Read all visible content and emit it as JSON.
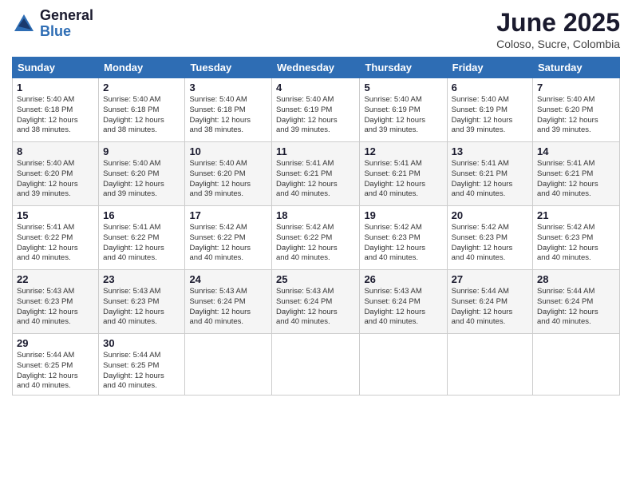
{
  "logo": {
    "general": "General",
    "blue": "Blue"
  },
  "title": "June 2025",
  "subtitle": "Coloso, Sucre, Colombia",
  "days_of_week": [
    "Sunday",
    "Monday",
    "Tuesday",
    "Wednesday",
    "Thursday",
    "Friday",
    "Saturday"
  ],
  "weeks": [
    [
      {
        "day": "1",
        "sunrise": "5:40 AM",
        "sunset": "6:18 PM",
        "daylight": "12 hours and 38 minutes."
      },
      {
        "day": "2",
        "sunrise": "5:40 AM",
        "sunset": "6:18 PM",
        "daylight": "12 hours and 38 minutes."
      },
      {
        "day": "3",
        "sunrise": "5:40 AM",
        "sunset": "6:18 PM",
        "daylight": "12 hours and 38 minutes."
      },
      {
        "day": "4",
        "sunrise": "5:40 AM",
        "sunset": "6:19 PM",
        "daylight": "12 hours and 39 minutes."
      },
      {
        "day": "5",
        "sunrise": "5:40 AM",
        "sunset": "6:19 PM",
        "daylight": "12 hours and 39 minutes."
      },
      {
        "day": "6",
        "sunrise": "5:40 AM",
        "sunset": "6:19 PM",
        "daylight": "12 hours and 39 minutes."
      },
      {
        "day": "7",
        "sunrise": "5:40 AM",
        "sunset": "6:20 PM",
        "daylight": "12 hours and 39 minutes."
      }
    ],
    [
      {
        "day": "8",
        "sunrise": "5:40 AM",
        "sunset": "6:20 PM",
        "daylight": "12 hours and 39 minutes."
      },
      {
        "day": "9",
        "sunrise": "5:40 AM",
        "sunset": "6:20 PM",
        "daylight": "12 hours and 39 minutes."
      },
      {
        "day": "10",
        "sunrise": "5:40 AM",
        "sunset": "6:20 PM",
        "daylight": "12 hours and 39 minutes."
      },
      {
        "day": "11",
        "sunrise": "5:41 AM",
        "sunset": "6:21 PM",
        "daylight": "12 hours and 40 minutes."
      },
      {
        "day": "12",
        "sunrise": "5:41 AM",
        "sunset": "6:21 PM",
        "daylight": "12 hours and 40 minutes."
      },
      {
        "day": "13",
        "sunrise": "5:41 AM",
        "sunset": "6:21 PM",
        "daylight": "12 hours and 40 minutes."
      },
      {
        "day": "14",
        "sunrise": "5:41 AM",
        "sunset": "6:21 PM",
        "daylight": "12 hours and 40 minutes."
      }
    ],
    [
      {
        "day": "15",
        "sunrise": "5:41 AM",
        "sunset": "6:22 PM",
        "daylight": "12 hours and 40 minutes."
      },
      {
        "day": "16",
        "sunrise": "5:41 AM",
        "sunset": "6:22 PM",
        "daylight": "12 hours and 40 minutes."
      },
      {
        "day": "17",
        "sunrise": "5:42 AM",
        "sunset": "6:22 PM",
        "daylight": "12 hours and 40 minutes."
      },
      {
        "day": "18",
        "sunrise": "5:42 AM",
        "sunset": "6:22 PM",
        "daylight": "12 hours and 40 minutes."
      },
      {
        "day": "19",
        "sunrise": "5:42 AM",
        "sunset": "6:23 PM",
        "daylight": "12 hours and 40 minutes."
      },
      {
        "day": "20",
        "sunrise": "5:42 AM",
        "sunset": "6:23 PM",
        "daylight": "12 hours and 40 minutes."
      },
      {
        "day": "21",
        "sunrise": "5:42 AM",
        "sunset": "6:23 PM",
        "daylight": "12 hours and 40 minutes."
      }
    ],
    [
      {
        "day": "22",
        "sunrise": "5:43 AM",
        "sunset": "6:23 PM",
        "daylight": "12 hours and 40 minutes."
      },
      {
        "day": "23",
        "sunrise": "5:43 AM",
        "sunset": "6:23 PM",
        "daylight": "12 hours and 40 minutes."
      },
      {
        "day": "24",
        "sunrise": "5:43 AM",
        "sunset": "6:24 PM",
        "daylight": "12 hours and 40 minutes."
      },
      {
        "day": "25",
        "sunrise": "5:43 AM",
        "sunset": "6:24 PM",
        "daylight": "12 hours and 40 minutes."
      },
      {
        "day": "26",
        "sunrise": "5:43 AM",
        "sunset": "6:24 PM",
        "daylight": "12 hours and 40 minutes."
      },
      {
        "day": "27",
        "sunrise": "5:44 AM",
        "sunset": "6:24 PM",
        "daylight": "12 hours and 40 minutes."
      },
      {
        "day": "28",
        "sunrise": "5:44 AM",
        "sunset": "6:24 PM",
        "daylight": "12 hours and 40 minutes."
      }
    ],
    [
      {
        "day": "29",
        "sunrise": "5:44 AM",
        "sunset": "6:25 PM",
        "daylight": "12 hours and 40 minutes."
      },
      {
        "day": "30",
        "sunrise": "5:44 AM",
        "sunset": "6:25 PM",
        "daylight": "12 hours and 40 minutes."
      },
      null,
      null,
      null,
      null,
      null
    ]
  ]
}
